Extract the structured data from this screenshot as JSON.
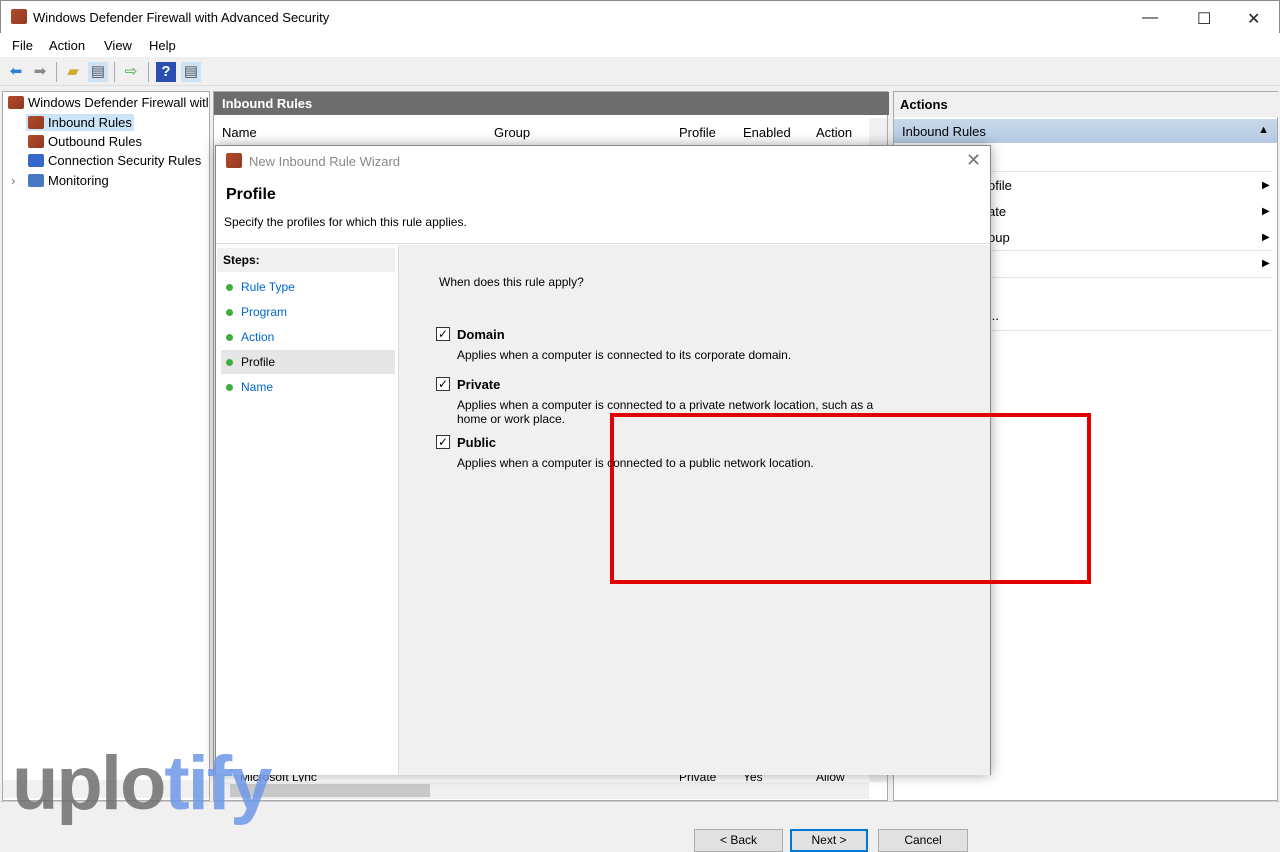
{
  "window": {
    "title": "Windows Defender Firewall with Advanced Security",
    "minimize": "—",
    "maximize": "☐",
    "close": "✕"
  },
  "menu": [
    "File",
    "Action",
    "View",
    "Help"
  ],
  "toolbar": {
    "icons": [
      "back-arrow-icon",
      "forward-arrow-icon",
      "up-folder-icon",
      "show-hide-console-tree-icon",
      "export-list-icon",
      "help-icon",
      "show-hide-action-pane-icon"
    ]
  },
  "tree": {
    "root": "Windows Defender Firewall witl",
    "items": [
      "Inbound Rules",
      "Outbound Rules",
      "Connection Security Rules",
      "Monitoring"
    ],
    "selected": "Inbound Rules"
  },
  "list": {
    "title": "Inbound Rules",
    "columns": [
      "Name",
      "Group",
      "Profile",
      "Enabled",
      "Action"
    ],
    "rows": [
      {
        "name": "Microsoft Lync",
        "profile": "Private",
        "enabled": "Yes",
        "action": "Allow"
      }
    ]
  },
  "actions": {
    "title": "Actions",
    "section": "Inbound Rules",
    "items": [
      "ofile",
      "ate",
      "oup",
      "",
      "..."
    ]
  },
  "dialog": {
    "title": "New Inbound Rule Wizard",
    "heading": "Profile",
    "subtitle": "Specify the profiles for which this rule applies.",
    "steps_label": "Steps:",
    "steps": [
      "Rule Type",
      "Program",
      "Action",
      "Profile",
      "Name"
    ],
    "current_step": "Profile",
    "question": "When does this rule apply?",
    "options": [
      {
        "label": "Domain",
        "desc": "Applies when a computer is connected to its corporate domain.",
        "checked": true
      },
      {
        "label": "Private",
        "desc": "Applies when a computer is connected to a private network location, such as a home or work place.",
        "checked": true
      },
      {
        "label": "Public",
        "desc": "Applies when a computer is connected to a public network location.",
        "checked": true
      }
    ],
    "buttons": {
      "back": "< Back",
      "next": "Next >",
      "cancel": "Cancel"
    },
    "highlight_color": "#e30000"
  },
  "watermark": {
    "part1": "uplo",
    "part2": "tify"
  }
}
